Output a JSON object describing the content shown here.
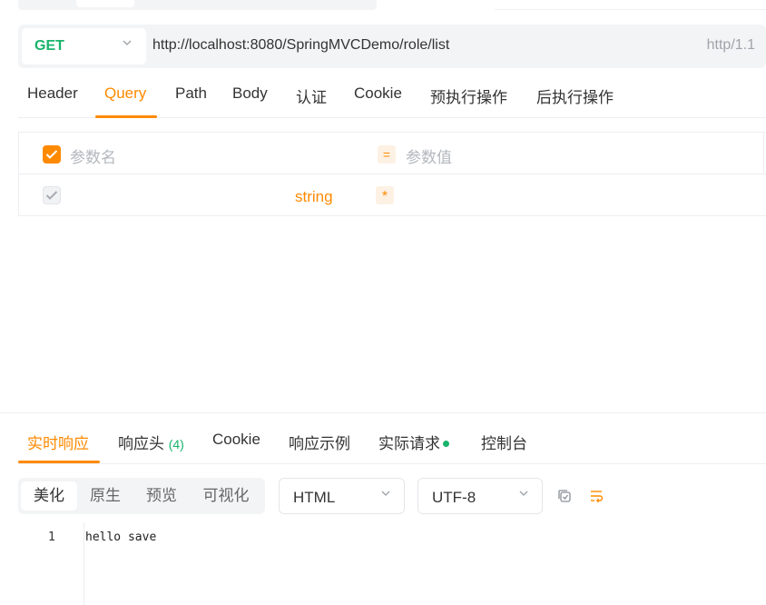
{
  "request": {
    "method": "GET",
    "url": "http://localhost:8080/SpringMVCDemo/role/list",
    "http_version": "http/1.1"
  },
  "request_tabs": [
    {
      "label": "Header"
    },
    {
      "label": "Query"
    },
    {
      "label": "Path"
    },
    {
      "label": "Body"
    },
    {
      "label": "认证"
    },
    {
      "label": "Cookie"
    },
    {
      "label": "预执行操作"
    },
    {
      "label": "后执行操作"
    }
  ],
  "active_request_tab": "Query",
  "params": {
    "name_placeholder": "参数名",
    "value_placeholder": "参数值",
    "eq_symbol": "=",
    "row": {
      "type": "string",
      "required_mark": "*"
    }
  },
  "response_tabs": [
    {
      "label": "实时响应"
    },
    {
      "label": "响应头",
      "count": "(4)"
    },
    {
      "label": "Cookie"
    },
    {
      "label": "响应示例"
    },
    {
      "label": "实际请求"
    },
    {
      "label": "控制台"
    }
  ],
  "active_response_tab": "实时响应",
  "view_modes": [
    {
      "label": "美化"
    },
    {
      "label": "原生"
    },
    {
      "label": "预览"
    },
    {
      "label": "可视化"
    }
  ],
  "active_view_mode": "美化",
  "format_select": "HTML",
  "encoding_select": "UTF-8",
  "response_body": {
    "line_number": "1",
    "text": "hello save"
  },
  "colors": {
    "accent": "#ff8a00",
    "method_get": "#19b36b"
  }
}
